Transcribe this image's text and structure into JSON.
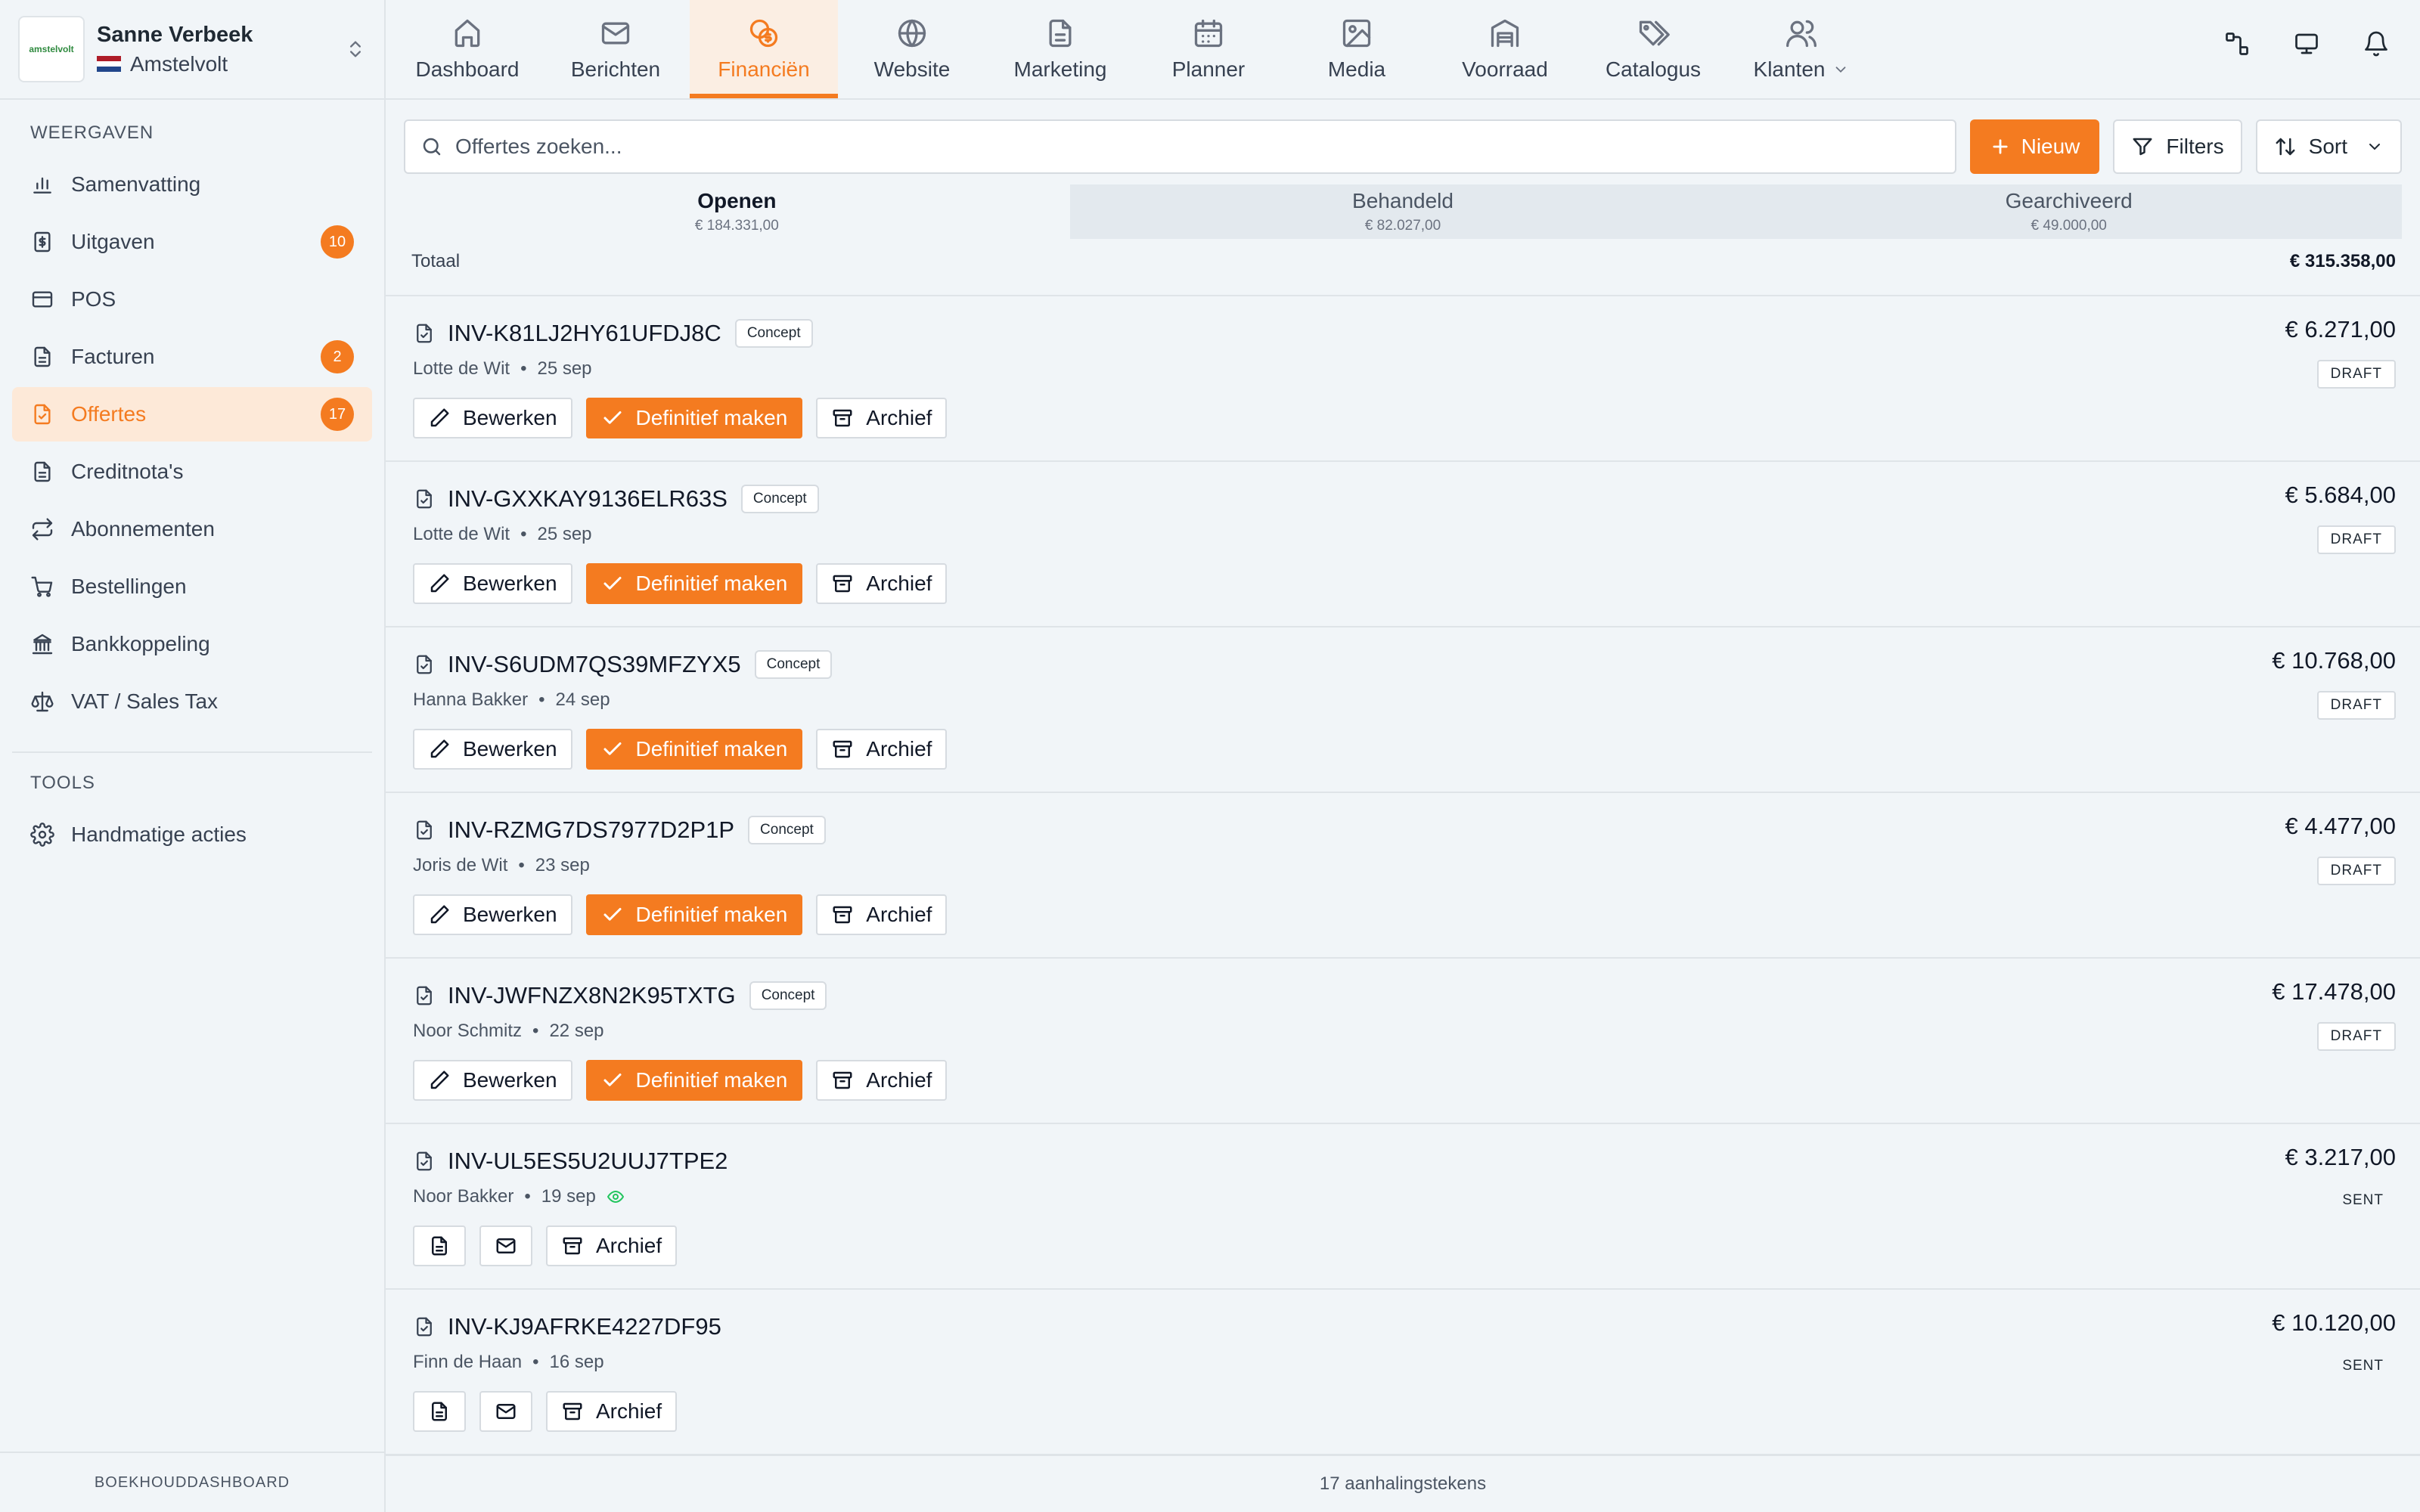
{
  "account": {
    "name": "Sanne Verbeek",
    "location": "Amstelvolt",
    "logo_text": "amstelvolt"
  },
  "sidebar": {
    "section_views": "WEERGAVEN",
    "items": [
      {
        "label": "Samenvatting",
        "icon": "bar-chart-icon",
        "badge": ""
      },
      {
        "label": "Uitgaven",
        "icon": "receipt-icon",
        "badge": "10"
      },
      {
        "label": "POS",
        "icon": "credit-card-icon",
        "badge": ""
      },
      {
        "label": "Facturen",
        "icon": "document-icon",
        "badge": "2"
      },
      {
        "label": "Offertes",
        "icon": "quote-document-icon",
        "badge": "17",
        "active": true
      },
      {
        "label": "Creditnota's",
        "icon": "document-icon",
        "badge": ""
      },
      {
        "label": "Abonnementen",
        "icon": "repeat-icon",
        "badge": ""
      },
      {
        "label": "Bestellingen",
        "icon": "cart-icon",
        "badge": ""
      },
      {
        "label": "Bankkoppeling",
        "icon": "bank-icon",
        "badge": ""
      },
      {
        "label": "VAT / Sales Tax",
        "icon": "scale-icon",
        "badge": ""
      }
    ],
    "section_tools": "TOOLS",
    "tools": [
      {
        "label": "Handmatige acties",
        "icon": "gear-icon"
      }
    ],
    "footer": "BOEKHOUDDASHBOARD"
  },
  "topnav": {
    "tabs": [
      {
        "label": "Dashboard",
        "icon": "home-icon"
      },
      {
        "label": "Berichten",
        "icon": "mail-icon"
      },
      {
        "label": "Financiën",
        "icon": "coins-icon",
        "active": true
      },
      {
        "label": "Website",
        "icon": "globe-icon"
      },
      {
        "label": "Marketing",
        "icon": "document-icon"
      },
      {
        "label": "Planner",
        "icon": "calendar-icon"
      },
      {
        "label": "Media",
        "icon": "image-icon"
      },
      {
        "label": "Voorraad",
        "icon": "warehouse-icon"
      },
      {
        "label": "Catalogus",
        "icon": "tags-icon"
      },
      {
        "label": "Klanten",
        "icon": "users-icon"
      }
    ]
  },
  "toolbar": {
    "search_placeholder": "Offertes zoeken...",
    "new_label": "Nieuw",
    "filters_label": "Filters",
    "sort_label": "Sort"
  },
  "status_tabs": [
    {
      "label": "Openen",
      "value": "€ 184.331,00",
      "active": true
    },
    {
      "label": "Behandeld",
      "value": "€ 82.027,00"
    },
    {
      "label": "Gearchiveerd",
      "value": "€ 49.000,00"
    }
  ],
  "totals": {
    "label": "Totaal",
    "value": "€ 315.358,00"
  },
  "actions": {
    "edit": "Bewerken",
    "finalize": "Definitief maken",
    "archive": "Archief"
  },
  "quotes": [
    {
      "id": "INV-K81LJ2HY61UFDJ8C",
      "tag": "Concept",
      "customer": "Lotte de Wit",
      "date": "25 sep",
      "amount": "€ 6.271,00",
      "status": "DRAFT"
    },
    {
      "id": "INV-GXXKAY9136ELR63S",
      "tag": "Concept",
      "customer": "Lotte de Wit",
      "date": "25 sep",
      "amount": "€ 5.684,00",
      "status": "DRAFT"
    },
    {
      "id": "INV-S6UDM7QS39MFZYX5",
      "tag": "Concept",
      "customer": "Hanna Bakker",
      "date": "24 sep",
      "amount": "€ 10.768,00",
      "status": "DRAFT"
    },
    {
      "id": "INV-RZMG7DS7977D2P1P",
      "tag": "Concept",
      "customer": "Joris de Wit",
      "date": "23 sep",
      "amount": "€ 4.477,00",
      "status": "DRAFT"
    },
    {
      "id": "INV-JWFNZX8N2K95TXTG",
      "tag": "Concept",
      "customer": "Noor Schmitz",
      "date": "22 sep",
      "amount": "€ 17.478,00",
      "status": "DRAFT"
    },
    {
      "id": "INV-UL5ES5U2UUJ7TPE2",
      "tag": "",
      "customer": "Noor Bakker",
      "date": "19 sep",
      "amount": "€ 3.217,00",
      "status": "SENT",
      "viewed": true
    },
    {
      "id": "INV-KJ9AFRKE4227DF95",
      "tag": "",
      "customer": "Finn de Haan",
      "date": "16 sep",
      "amount": "€ 10.120,00",
      "status": "SENT"
    }
  ],
  "footer_count": "17 aanhalingstekens",
  "colors": {
    "accent": "#f47b20",
    "background": "#f1f5f8",
    "border": "#dfe4e8"
  }
}
